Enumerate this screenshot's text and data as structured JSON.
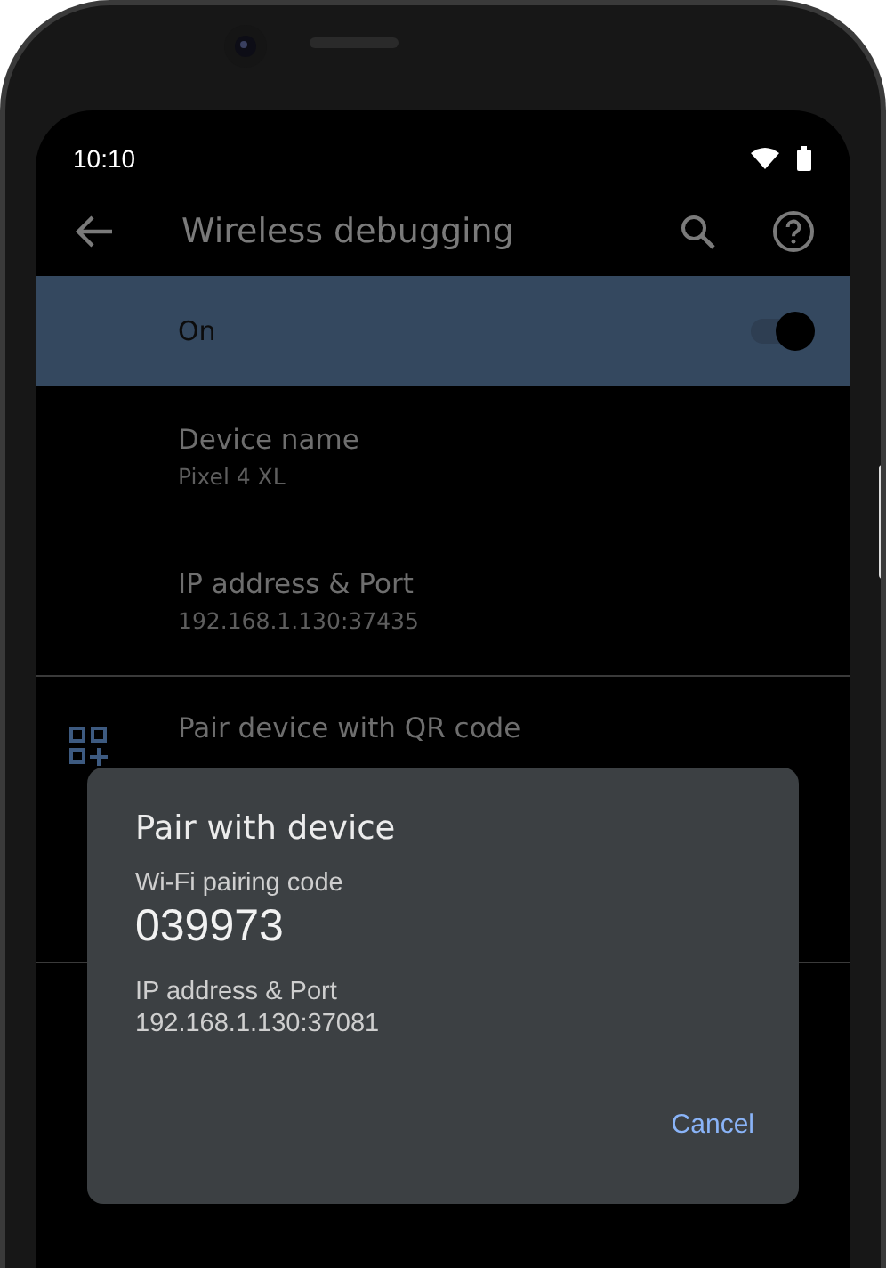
{
  "status_bar": {
    "time": "10:10"
  },
  "app_bar": {
    "title": "Wireless debugging"
  },
  "main_switch": {
    "label": "On",
    "on": true
  },
  "preferences": [
    {
      "kind": "info",
      "title": "Device name",
      "summary": "Pixel 4 XL"
    },
    {
      "kind": "info",
      "title": "IP address & Port",
      "summary": "192.168.1.130:37435"
    },
    {
      "kind": "qr",
      "title": "Pair device with QR code"
    }
  ],
  "dialog": {
    "title": "Pair with device",
    "fields": [
      {
        "kind": "code",
        "label": "Wi-Fi pairing code",
        "value": "039973"
      },
      {
        "kind": "plain",
        "label": "IP address & Port",
        "value": "192.168.1.130:37081"
      }
    ],
    "button": "Cancel"
  }
}
